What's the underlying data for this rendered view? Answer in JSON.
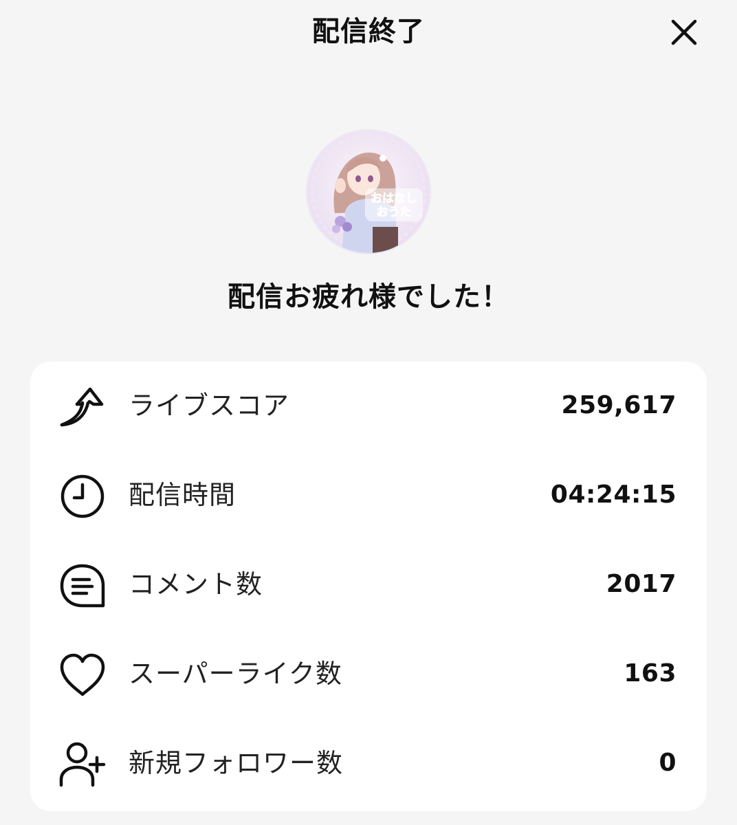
{
  "header": {
    "title": "配信終了",
    "close_icon": "close-icon"
  },
  "avatar": {
    "logo_text_line1": "おはなし",
    "logo_text_line2": "おうた"
  },
  "message": "配信お疲れ様でした！",
  "stats": [
    {
      "icon": "trending-up-arrow-icon",
      "label": "ライブスコア",
      "value": "259,617"
    },
    {
      "icon": "clock-icon",
      "label": "配信時間",
      "value": "04:24:15"
    },
    {
      "icon": "comment-bubble-icon",
      "label": "コメント数",
      "value": "2017"
    },
    {
      "icon": "heart-icon",
      "label": "スーパーライク数",
      "value": "163"
    },
    {
      "icon": "add-user-icon",
      "label": "新規フォロワー数",
      "value": "0"
    }
  ],
  "colors": {
    "background": "#f5f5f5",
    "card": "#ffffff",
    "text": "#111111"
  }
}
